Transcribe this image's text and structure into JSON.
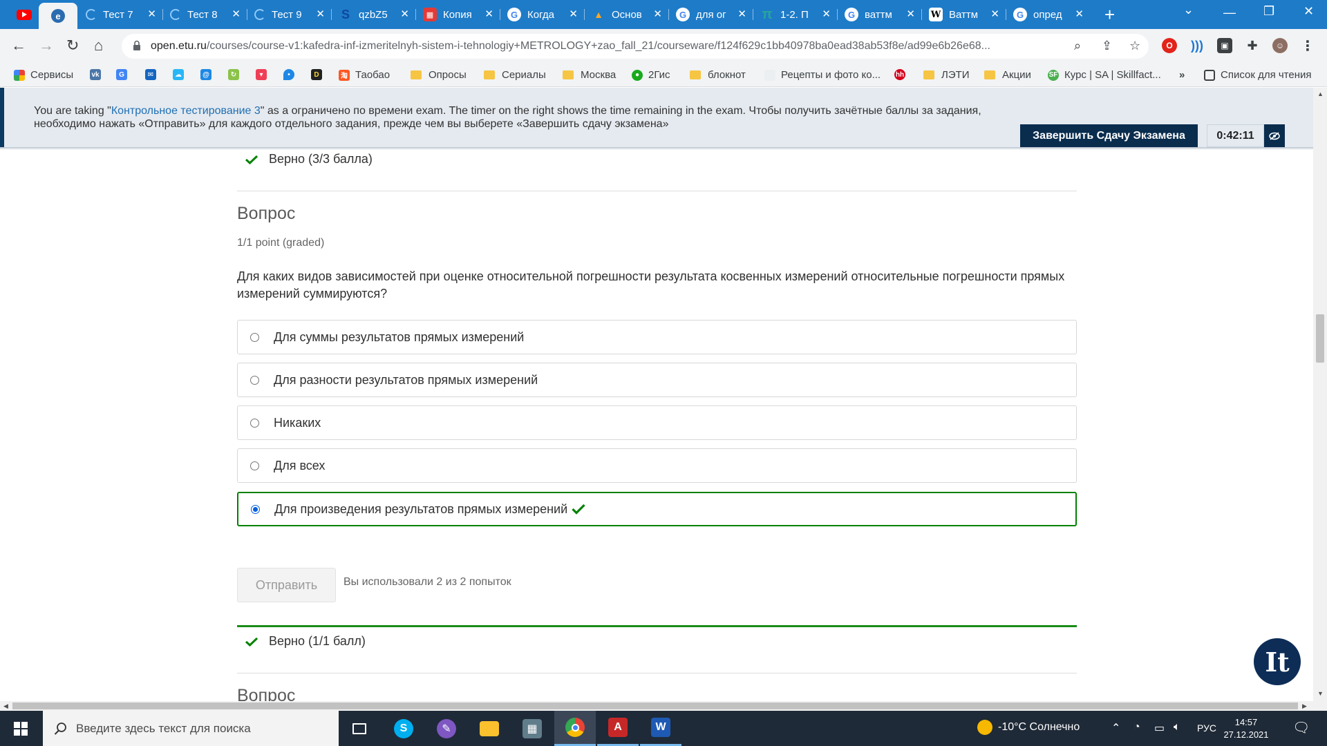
{
  "browser": {
    "tabs": [
      {
        "title": "",
        "favicon": "youtube-icon",
        "color": "#ff0000"
      },
      {
        "title": "",
        "favicon": "edge-reading-icon",
        "color": "#2b6cb0"
      },
      {
        "title": "Тест 7",
        "favicon": "loading-icon",
        "color": "#90caf9"
      },
      {
        "title": "Тест 8",
        "favicon": "loading-icon",
        "color": "#90caf9"
      },
      {
        "title": "Тест 9",
        "favicon": "loading-icon",
        "color": "#90caf9"
      },
      {
        "title": "qzbZ5",
        "favicon": "s-icon",
        "color": "#0d47a1"
      },
      {
        "title": "Копия",
        "favicon": "sheet-icon",
        "color": "#e53935"
      },
      {
        "title": "Когда",
        "favicon": "google-icon",
        "color": "#ffffff"
      },
      {
        "title": "Основ",
        "favicon": "site-icon",
        "color": "#f9a825"
      },
      {
        "title": "для ог",
        "favicon": "google-icon",
        "color": "#ffffff"
      },
      {
        "title": "1-2. П",
        "favicon": "pi-icon",
        "color": "#26a69a"
      },
      {
        "title": "ваттм",
        "favicon": "google-icon",
        "color": "#ffffff"
      },
      {
        "title": "Ваттм",
        "favicon": "wikipedia-icon",
        "color": "#ffffff"
      },
      {
        "title": "опред",
        "favicon": "google-icon",
        "color": "#ffffff"
      }
    ],
    "url_host": "open.etu.ru",
    "url_path": "/courses/course-v1:kafedra-inf-izmeritelnyh-sistem-i-tehnologiy+METROLOGY+zao_fall_21/courseware/f124f629c1bb40978ba0ead38ab53f8e/ad99e6b26e68...",
    "bookmarks": [
      {
        "label": "Сервисы",
        "icon": "apps-icon"
      },
      {
        "label": "",
        "icon": "vk-icon"
      },
      {
        "label": "",
        "icon": "translate-icon"
      },
      {
        "label": "",
        "icon": "mail-icon"
      },
      {
        "label": "",
        "icon": "cloud-icon"
      },
      {
        "label": "",
        "icon": "at-icon"
      },
      {
        "label": "",
        "icon": "sync-icon"
      },
      {
        "label": "",
        "icon": "pocket-icon"
      },
      {
        "label": "",
        "icon": "drop-icon"
      },
      {
        "label": "",
        "icon": "d-icon"
      },
      {
        "label": "Таобао",
        "icon": "taobao-icon"
      },
      {
        "label": "Опросы",
        "icon": "folder-icon"
      },
      {
        "label": "Сериалы",
        "icon": "folder-icon"
      },
      {
        "label": "Москва",
        "icon": "folder-icon"
      },
      {
        "label": "2Гис",
        "icon": "2gis-icon"
      },
      {
        "label": "блокнот",
        "icon": "folder-icon"
      },
      {
        "label": "Рецепты и фото ко...",
        "icon": "recipe-icon"
      },
      {
        "label": "",
        "icon": "hh-icon"
      },
      {
        "label": "ЛЭТИ",
        "icon": "folder-icon"
      },
      {
        "label": "Акции",
        "icon": "folder-icon"
      },
      {
        "label": "Курс | SA | Skillfact...",
        "icon": "skillfactory-icon"
      }
    ],
    "more_bookmarks": "»",
    "reading_list": "Список для чтения"
  },
  "exam": {
    "banner_prefix": "You are taking \"",
    "exam_name": "Контрольное тестирование 3",
    "banner_middle": "\" as a ограничено по времени exam. The timer on the right shows the time remaining in the exam. Чтобы получить зачётные баллы за задания, необходимо нажать «Отправить» для каждого отдельного задания, прежде чем вы выберете «Завершить сдачу экзамена»",
    "end_button": "Завершить Сдачу Экзамена",
    "timer": "0:42:11"
  },
  "prev_result": "Верно (3/3 балла)",
  "question": {
    "heading": "Вопрос",
    "points": "1/1 point (graded)",
    "text": "Для каких видов зависимостей при оценке относительной погрешности результата косвенных измерений относительные погрешности прямых измерений суммируются?",
    "options": [
      {
        "label": "Для суммы результатов прямых измерений",
        "selected": false
      },
      {
        "label": "Для разности результатов прямых измерений",
        "selected": false
      },
      {
        "label": "Никаких",
        "selected": false
      },
      {
        "label": "Для всех",
        "selected": false
      },
      {
        "label": "Для произведения результатов прямых измерений",
        "selected": true,
        "correct": true
      }
    ],
    "submit_label": "Отправить",
    "attempts": "Вы использовали 2 из 2 попыток",
    "result": "Верно (1/1 балл)"
  },
  "next_question_heading": "Вопрос",
  "fab_label": "It",
  "taskbar": {
    "search_placeholder": "Введите здесь текст для поиска",
    "weather": "-10°C  Солнечно",
    "lang": "РУС",
    "time": "14:57",
    "date": "27.12.2021"
  },
  "colors": {
    "tabstrip": "#1e7bc8",
    "banner_bg": "#e5eaf0",
    "navy": "#0a2d4e",
    "correct_green": "#008100",
    "link_blue": "#1f6fb3"
  }
}
